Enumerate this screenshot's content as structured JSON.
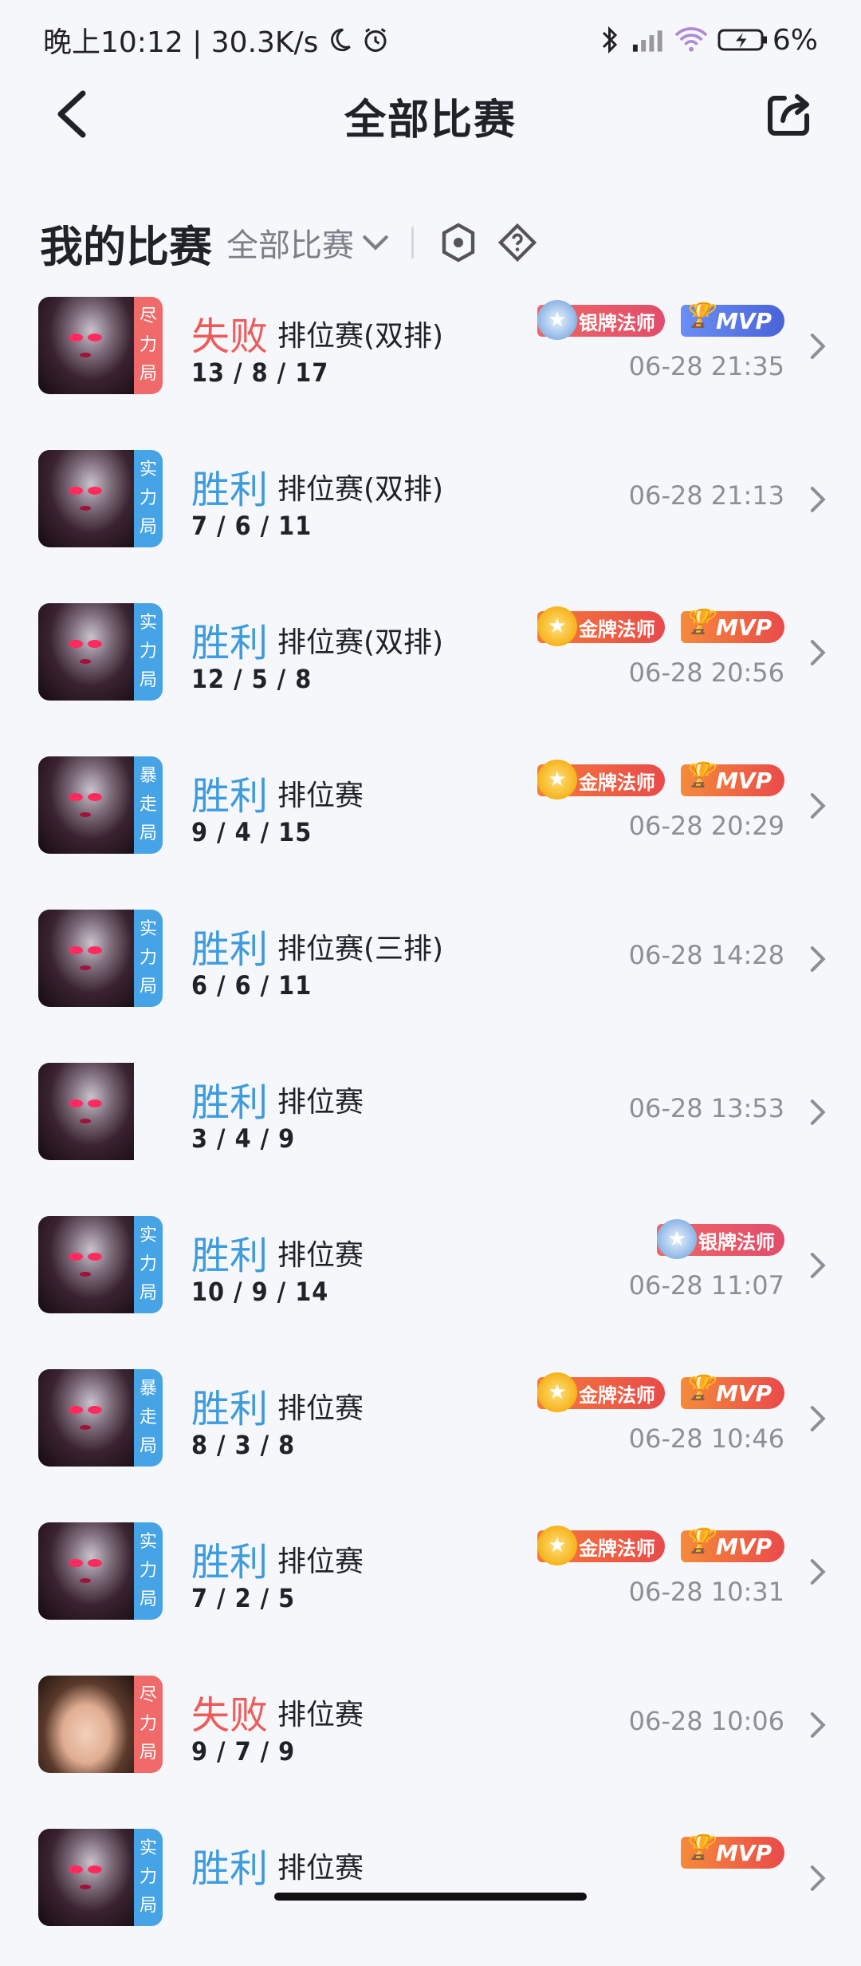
{
  "status": {
    "left_text": "晚上10:12 | 30.3K/s",
    "battery": "6%"
  },
  "header": {
    "title": "全部比赛"
  },
  "section": {
    "title": "我的比赛",
    "filter_label": "全部比赛"
  },
  "matches": [
    {
      "result": "失败",
      "mode": "排位赛(双排)",
      "kda": "13 / 8 / 17",
      "time": "06-28 21:35",
      "tag": [
        "尽",
        "力",
        "局"
      ],
      "badge": "银牌法师",
      "mvp": "MVP"
    },
    {
      "result": "胜利",
      "mode": "排位赛(双排)",
      "kda": "7 / 6 / 11",
      "time": "06-28 21:13",
      "tag": [
        "实",
        "力",
        "局"
      ]
    },
    {
      "result": "胜利",
      "mode": "排位赛(双排)",
      "kda": "12 / 5 / 8",
      "time": "06-28 20:56",
      "tag": [
        "实",
        "力",
        "局"
      ],
      "badge": "金牌法师",
      "mvp": "MVP"
    },
    {
      "result": "胜利",
      "mode": "排位赛",
      "kda": "9 / 4 / 15",
      "time": "06-28 20:29",
      "tag": [
        "暴",
        "走",
        "局"
      ],
      "badge": "金牌法师",
      "mvp": "MVP"
    },
    {
      "result": "胜利",
      "mode": "排位赛(三排)",
      "kda": "6 / 6 / 11",
      "time": "06-28 14:28",
      "tag": [
        "实",
        "力",
        "局"
      ]
    },
    {
      "result": "胜利",
      "mode": "排位赛",
      "kda": "3 / 4 / 9",
      "time": "06-28 13:53"
    },
    {
      "result": "胜利",
      "mode": "排位赛",
      "kda": "10 / 9 / 14",
      "time": "06-28 11:07",
      "tag": [
        "实",
        "力",
        "局"
      ],
      "badge": "银牌法师"
    },
    {
      "result": "胜利",
      "mode": "排位赛",
      "kda": "8 / 3 / 8",
      "time": "06-28 10:46",
      "tag": [
        "暴",
        "走",
        "局"
      ],
      "badge": "金牌法师",
      "mvp": "MVP"
    },
    {
      "result": "胜利",
      "mode": "排位赛",
      "kda": "7 / 2 / 5",
      "time": "06-28 10:31",
      "tag": [
        "实",
        "力",
        "局"
      ],
      "badge": "金牌法师",
      "mvp": "MVP"
    },
    {
      "result": "失败",
      "mode": "排位赛",
      "kda": "9 / 7 / 9",
      "time": "06-28 10:06",
      "tag": [
        "尽",
        "力",
        "局"
      ]
    },
    {
      "result": "胜利",
      "mode": "排位赛",
      "kda": "",
      "time": "",
      "tag": [
        "实",
        "力",
        "局"
      ],
      "mvp": "MVP"
    }
  ]
}
